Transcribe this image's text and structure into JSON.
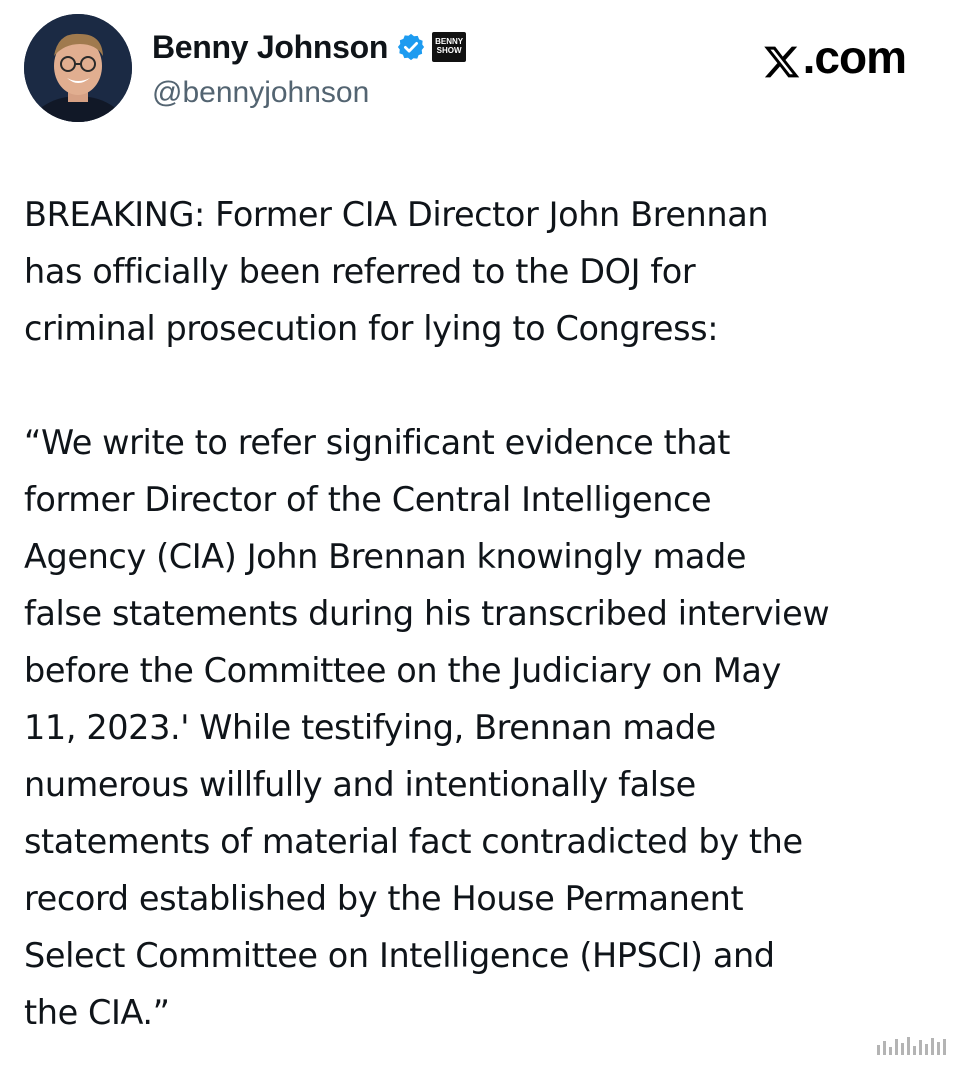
{
  "user": {
    "display_name": "Benny Johnson",
    "handle": "@bennyjohnson",
    "verified": true,
    "verified_color": "#1d9bf0",
    "affiliate_badge_text": "BENNY SHOW",
    "avatar_icon": "profile-photo"
  },
  "site": {
    "label": ".com",
    "logo_icon": "x-logo-icon"
  },
  "tweet": {
    "paragraphs": [
      "BREAKING: Former CIA Director John Brennan\nhas officially been referred to the DOJ for\ncriminal prosecution for lying to Congress:",
      "“We write to refer significant evidence that\nformer Director of the Central Intelligence\nAgency (CIA) John Brennan knowingly made\nfalse statements during his transcribed interview\nbefore the Committee on the Judiciary on May\n11, 2023.' While testifying, Brennan made\nnumerous willfully and intentionally false\nstatements of material fact contradicted by the\nrecord established by the House Permanent\nSelect Committee on Intelligence (HPSCI) and\nthe CIA.”"
    ]
  }
}
